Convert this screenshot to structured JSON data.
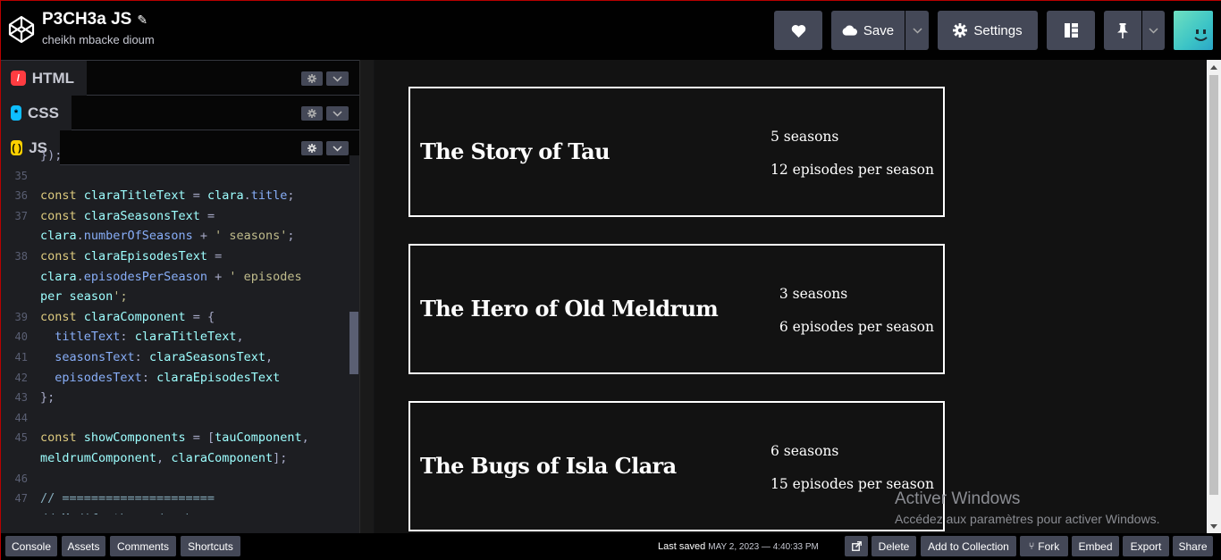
{
  "header": {
    "pen_title": "P3CH3a JS",
    "author": "cheikh mbacke dioum",
    "save_label": "Save",
    "settings_label": "Settings"
  },
  "panels": [
    {
      "label": "HTML",
      "icon": "html-icon",
      "color": "#ff3c41"
    },
    {
      "label": "CSS",
      "icon": "css-icon",
      "color": "#0ebeff"
    },
    {
      "label": "JS",
      "icon": "js-icon",
      "color": "#fcd000"
    }
  ],
  "code_lines": [
    {
      "n": "",
      "t": "});"
    },
    {
      "n": "35",
      "t": ""
    },
    {
      "n": "36",
      "t": "const claraTitleText = clara.title;"
    },
    {
      "n": "37",
      "t": "const claraSeasonsText ="
    },
    {
      "n": "",
      "t": "clara.numberOfSeasons + ' seasons';"
    },
    {
      "n": "38",
      "t": "const claraEpisodesText ="
    },
    {
      "n": "",
      "t": "clara.episodesPerSeason + ' episodes"
    },
    {
      "n": "",
      "t": "per season';"
    },
    {
      "n": "39",
      "t": "const claraComponent = {"
    },
    {
      "n": "40",
      "t": "  titleText: claraTitleText,"
    },
    {
      "n": "41",
      "t": "  seasonsText: claraSeasonsText,"
    },
    {
      "n": "42",
      "t": "  episodesText: claraEpisodesText"
    },
    {
      "n": "43",
      "t": "};"
    },
    {
      "n": "44",
      "t": ""
    },
    {
      "n": "45",
      "t": "const showComponents = [tauComponent,"
    },
    {
      "n": "",
      "t": "meldrumComponent, claraComponent];"
    },
    {
      "n": "46",
      "t": ""
    },
    {
      "n": "47",
      "t": "// ====================="
    },
    {
      "n": "48",
      "t": "// Modify the code above"
    }
  ],
  "shows": [
    {
      "title": "The Story of Tau",
      "seasons": "5 seasons",
      "episodes": "12 episodes per season"
    },
    {
      "title": "The Hero of Old Meldrum",
      "seasons": "3 seasons",
      "episodes": "6 episodes per season"
    },
    {
      "title": "The Bugs of Isla Clara",
      "seasons": "6 seasons",
      "episodes": "15 episodes per season"
    }
  ],
  "watermark": {
    "line1": "Activer Windows",
    "line2": "Accédez aux paramètres pour activer Windows."
  },
  "footer": {
    "console": "Console",
    "assets": "Assets",
    "comments": "Comments",
    "shortcuts": "Shortcuts",
    "last_saved_label": "Last saved",
    "last_saved_value": "MAY 2, 2023 — 4:40:33 PM",
    "delete": "Delete",
    "add_to_collection": "Add to Collection",
    "fork": "Fork",
    "embed": "Embed",
    "export": "Export",
    "share": "Share"
  }
}
